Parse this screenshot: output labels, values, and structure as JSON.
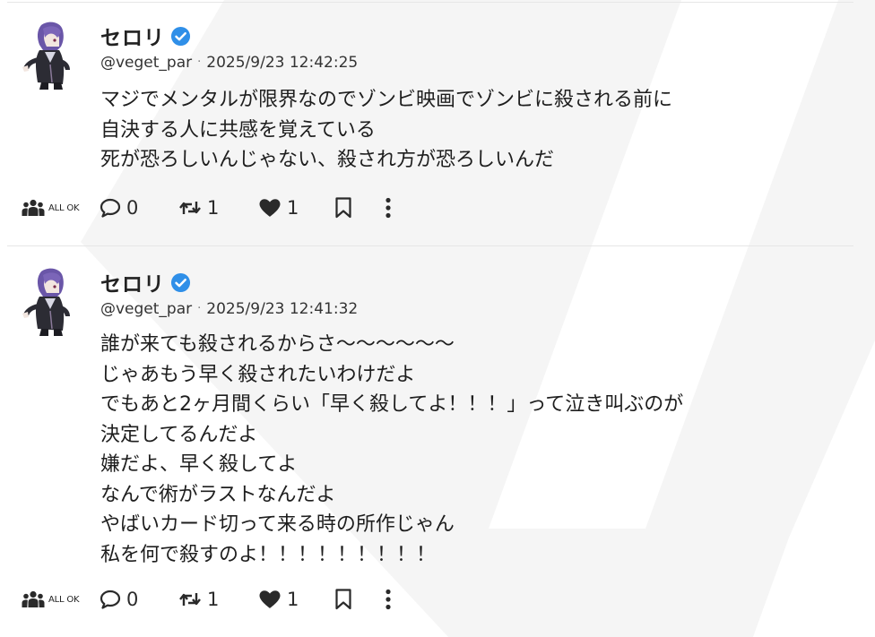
{
  "posts": [
    {
      "author": {
        "display_name": "セロリ",
        "handle": "@veget_par",
        "verified": true
      },
      "timestamp": "2025/9/23 12:42:25",
      "lines": [
        "マジでメンタルが限界なのでゾンビ映画でゾンビに殺される前に",
        "自決する人に共感を覚えている",
        "死が恐ろしいんじゃない、殺され方が恐ろしいんだ"
      ],
      "actions": {
        "scope": "ALL OK",
        "replies": "0",
        "reposts": "1",
        "likes": "1"
      }
    },
    {
      "author": {
        "display_name": "セロリ",
        "handle": "@veget_par",
        "verified": true
      },
      "timestamp": "2025/9/23 12:41:32",
      "lines": [
        "誰が来ても殺されるからさ〜〜〜〜〜〜",
        "じゃあもう早く殺されたいわけだよ",
        "でもあと2ヶ月間くらい「早く殺してよ！！！」って泣き叫ぶのが",
        "決定してるんだよ",
        "嫌だよ、早く殺してよ",
        "なんで術がラストなんだよ",
        "やばいカード切って来る時の所作じゃん",
        "私を何で殺すのよ！！！！！！！！！"
      ],
      "actions": {
        "scope": "ALL OK",
        "replies": "0",
        "reposts": "1",
        "likes": "1"
      }
    }
  ],
  "icons": {
    "verified": "verified-check-icon",
    "scope": "users-group-icon",
    "reply": "speech-bubble-icon",
    "repost": "repost-arrows-icon",
    "like": "heart-icon",
    "bookmark": "bookmark-icon",
    "more": "more-vertical-icon"
  },
  "colors": {
    "verified": "#2f8fe8",
    "divider": "#e6e6e6",
    "background_shape": "#f4f4f4"
  }
}
